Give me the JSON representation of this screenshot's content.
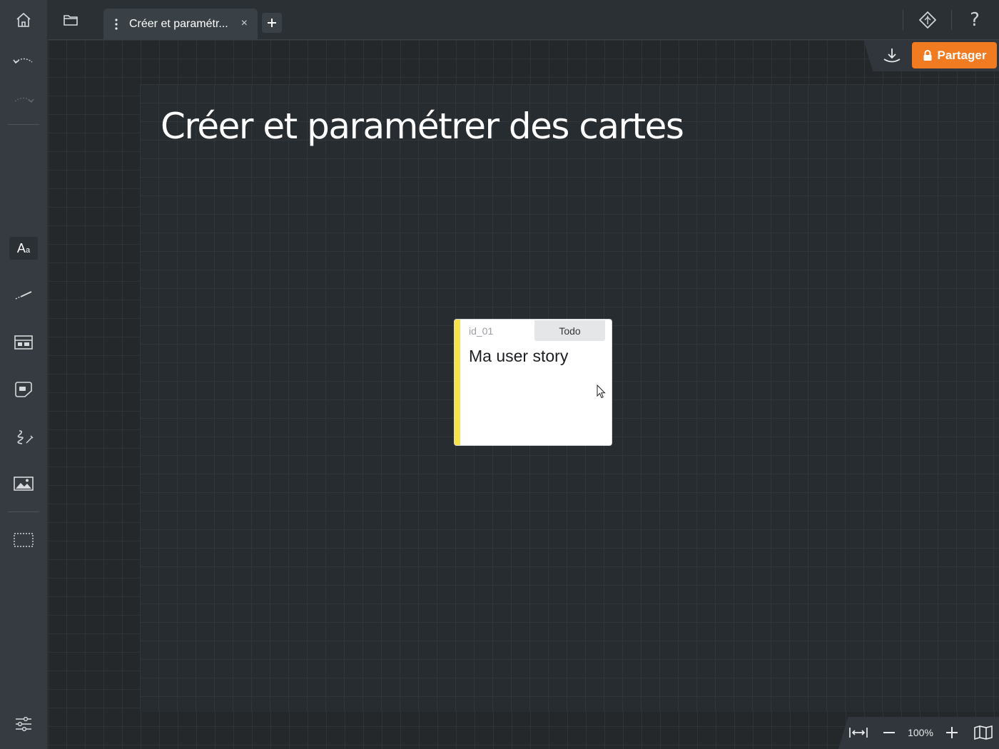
{
  "app": {
    "tab_title": "Créer et paramétr...",
    "tab_close": "×",
    "tab_add": "+"
  },
  "board": {
    "title": "Créer et paramétrer des cartes"
  },
  "share": {
    "label": "Partager"
  },
  "card": {
    "id": "id_01",
    "status": "Todo",
    "title": "Ma user story",
    "accent_color": "#f5e34a"
  },
  "zoom": {
    "level": "100%"
  },
  "colors": {
    "accent": "#f07b21",
    "sidebar": "#353b40",
    "canvas": "#24282b"
  },
  "icons": {
    "sidebar": [
      "undo-icon",
      "redo-icon",
      "text-tool-icon",
      "line-tool-icon",
      "card-tool-icon",
      "sticker-tool-icon",
      "draw-tool-icon",
      "image-tool-icon",
      "selection-tool-icon",
      "settings-sliders-icon"
    ],
    "topbar": [
      "home-icon",
      "folder-icon",
      "diamond-icon",
      "help-icon"
    ],
    "zoombar": [
      "fit-width-icon",
      "zoom-out-icon",
      "zoom-in-icon",
      "minimap-icon"
    ]
  }
}
